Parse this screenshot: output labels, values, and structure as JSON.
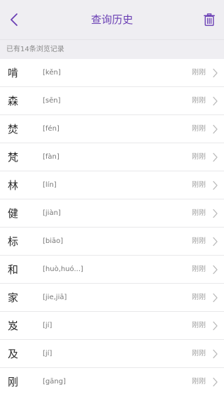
{
  "header": {
    "title": "查询历史",
    "accent_color": "#6a3fb4",
    "back_icon": "chevron-left-icon",
    "delete_icon": "trash-icon"
  },
  "history": {
    "summary": "已有14条浏览记录",
    "items": [
      {
        "char": "啃",
        "pinyin": "[kěn]",
        "time": "刚刚"
      },
      {
        "char": "森",
        "pinyin": "[sēn]",
        "time": "刚刚"
      },
      {
        "char": "焚",
        "pinyin": "[fén]",
        "time": "刚刚"
      },
      {
        "char": "梵",
        "pinyin": "[fàn]",
        "time": "刚刚"
      },
      {
        "char": "林",
        "pinyin": "[lín]",
        "time": "刚刚"
      },
      {
        "char": "健",
        "pinyin": "[jiàn]",
        "time": "刚刚"
      },
      {
        "char": "标",
        "pinyin": "[biāo]",
        "time": "刚刚"
      },
      {
        "char": "和",
        "pinyin": "[huò,huó...]",
        "time": "刚刚"
      },
      {
        "char": "家",
        "pinyin": "[jie,jiā]",
        "time": "刚刚"
      },
      {
        "char": "岌",
        "pinyin": "[jí]",
        "time": "刚刚"
      },
      {
        "char": "及",
        "pinyin": "[jí]",
        "time": "刚刚"
      },
      {
        "char": "刚",
        "pinyin": "[gāng]",
        "time": "刚刚"
      }
    ]
  }
}
